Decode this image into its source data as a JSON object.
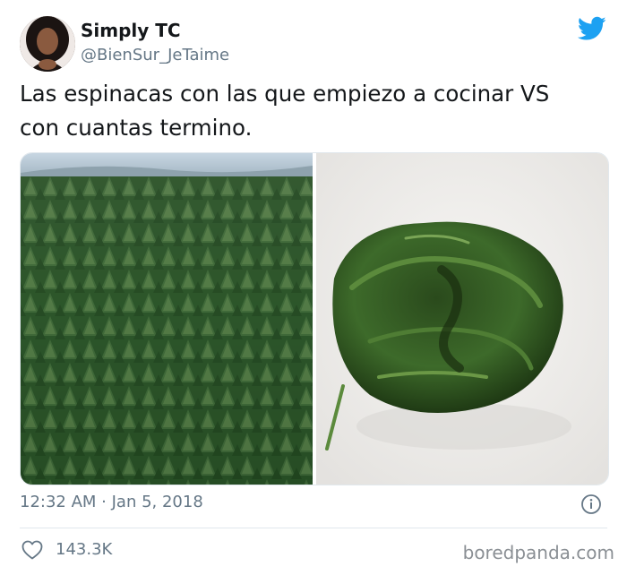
{
  "tweet": {
    "display_name": "Simply TC",
    "handle": "@BienSur_JeTaime",
    "text_line1": "Las espinacas con las que empiezo a cocinar VS",
    "text_line2": "con cuantas termino.",
    "timestamp": "12:32 AM · Jan 5, 2018",
    "like_count": "143.3K"
  },
  "images": {
    "left_description": "forest",
    "right_description": "cooked-spinach"
  },
  "icons": {
    "brand": "twitter-bird-icon",
    "info": "info-icon",
    "like": "heart-icon"
  },
  "colors": {
    "twitter_blue": "#1da1f2",
    "secondary_text": "#657786"
  },
  "watermark": "boredpanda.com"
}
